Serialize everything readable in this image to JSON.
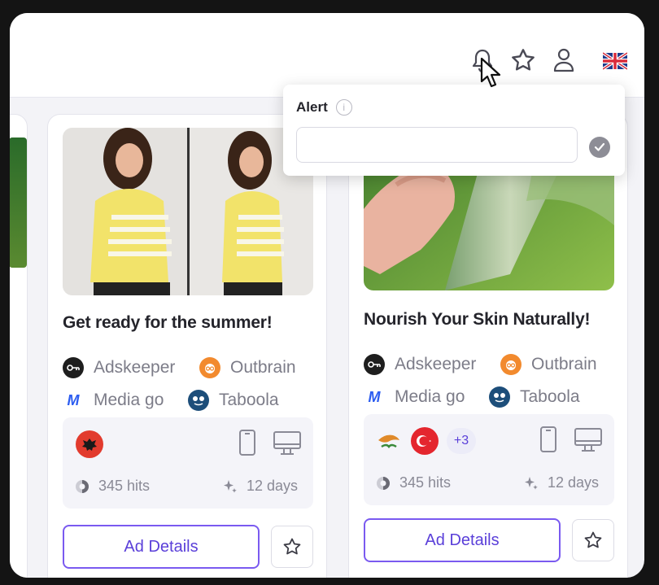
{
  "alert": {
    "title": "Alert",
    "info_icon": "i",
    "input_value": ""
  },
  "cards": [
    {
      "title": "Get ready for the summer!",
      "networks": [
        "Adskeeper",
        "Outbrain",
        "Media go",
        "Taboola"
      ],
      "countries": [
        "albania-flag"
      ],
      "hits": "345 hits",
      "days": "12 days",
      "details_label": "Ad Details"
    },
    {
      "title": "Nourish Your Skin Naturally!",
      "networks": [
        "Adskeeper",
        "Outbrain",
        "Media go",
        "Taboola"
      ],
      "countries": [
        "cyprus-flag",
        "turkey-flag"
      ],
      "more_countries": "+3",
      "hits": "345 hits",
      "days": "12 days",
      "details_label": "Ad Details"
    }
  ],
  "colors": {
    "accent": "#5a3fd9",
    "button_border": "#7a5af0",
    "page_bg": "#f3f3f7"
  },
  "icons": [
    "bell-icon",
    "star-icon",
    "user-icon",
    "uk-flag-icon",
    "cursor-icon",
    "mobile-icon",
    "desktop-icon",
    "hits-icon",
    "sparkle-icon",
    "check-icon",
    "info-icon"
  ]
}
